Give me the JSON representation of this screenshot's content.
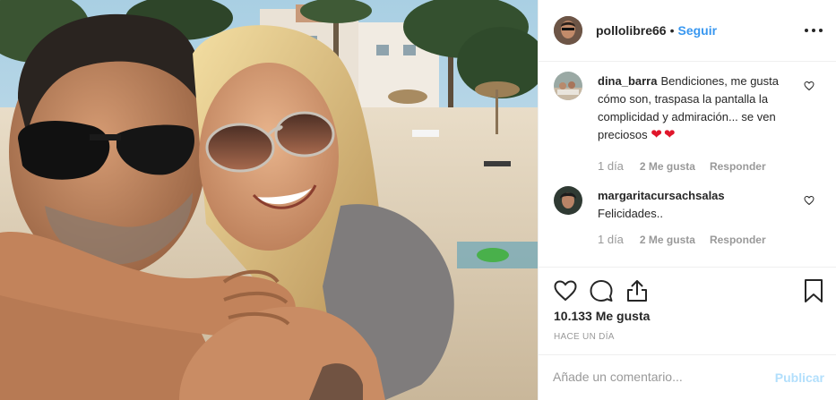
{
  "post": {
    "author": {
      "username": "pollolibre66",
      "separator": "•",
      "follow_label": "Seguir"
    },
    "more_icon": "more-horizontal-icon",
    "comments": [
      {
        "username": "dina_barra",
        "text": "Bendiciones, me gusta cómo son, traspasa la pantalla la complicidad y admiración... se ven preciosos",
        "emoji": "❤❤",
        "age": "1 día",
        "likes": "2 Me gusta",
        "reply": "Responder"
      },
      {
        "username": "margaritacursachsalas",
        "text": "Felicidades..",
        "age": "1 día",
        "likes": "2 Me gusta",
        "reply": "Responder"
      }
    ],
    "actions": {
      "icons": [
        "heart-icon",
        "comment-icon",
        "share-icon",
        "bookmark-icon"
      ],
      "like_count": "10.133 Me gusta",
      "time_ago": "HACE UN DÍA"
    },
    "add_comment": {
      "placeholder": "Añade un comentario...",
      "publish_label": "Publicar"
    },
    "colors": {
      "link_blue": "#3897f0",
      "publish_disabled": "#b2dffc",
      "muted": "#999999",
      "text": "#262626",
      "divider": "#efefef",
      "heart_red": "#e0162b"
    }
  }
}
